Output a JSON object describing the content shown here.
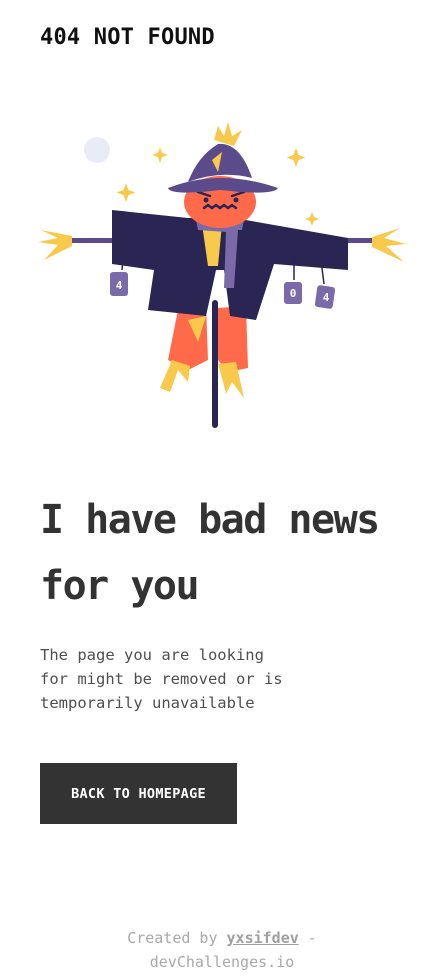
{
  "header": {
    "title": "404 NOT FOUND"
  },
  "headline": {
    "line1": "I have bad news",
    "line2": "for you"
  },
  "description": {
    "line1": "The page you are looking",
    "line2": "for might be removed or is",
    "line3": "temporarily unavailable"
  },
  "cta": {
    "label": "BACK TO HOMEPAGE"
  },
  "footer": {
    "prefix": "Created by",
    "author": "yxsifdev",
    "separator": "-",
    "site": "devChallenges.io"
  },
  "illustration": {
    "can_labels": [
      "4",
      "0",
      "4"
    ],
    "colors": {
      "coat": "#2b2553",
      "hat": "#5b4b8a",
      "face": "#ff6b4a",
      "straw": "#f8c94a",
      "scarf": "#7a6aa8",
      "pole": "#2b2553",
      "moon": "#e9ecf7"
    }
  }
}
